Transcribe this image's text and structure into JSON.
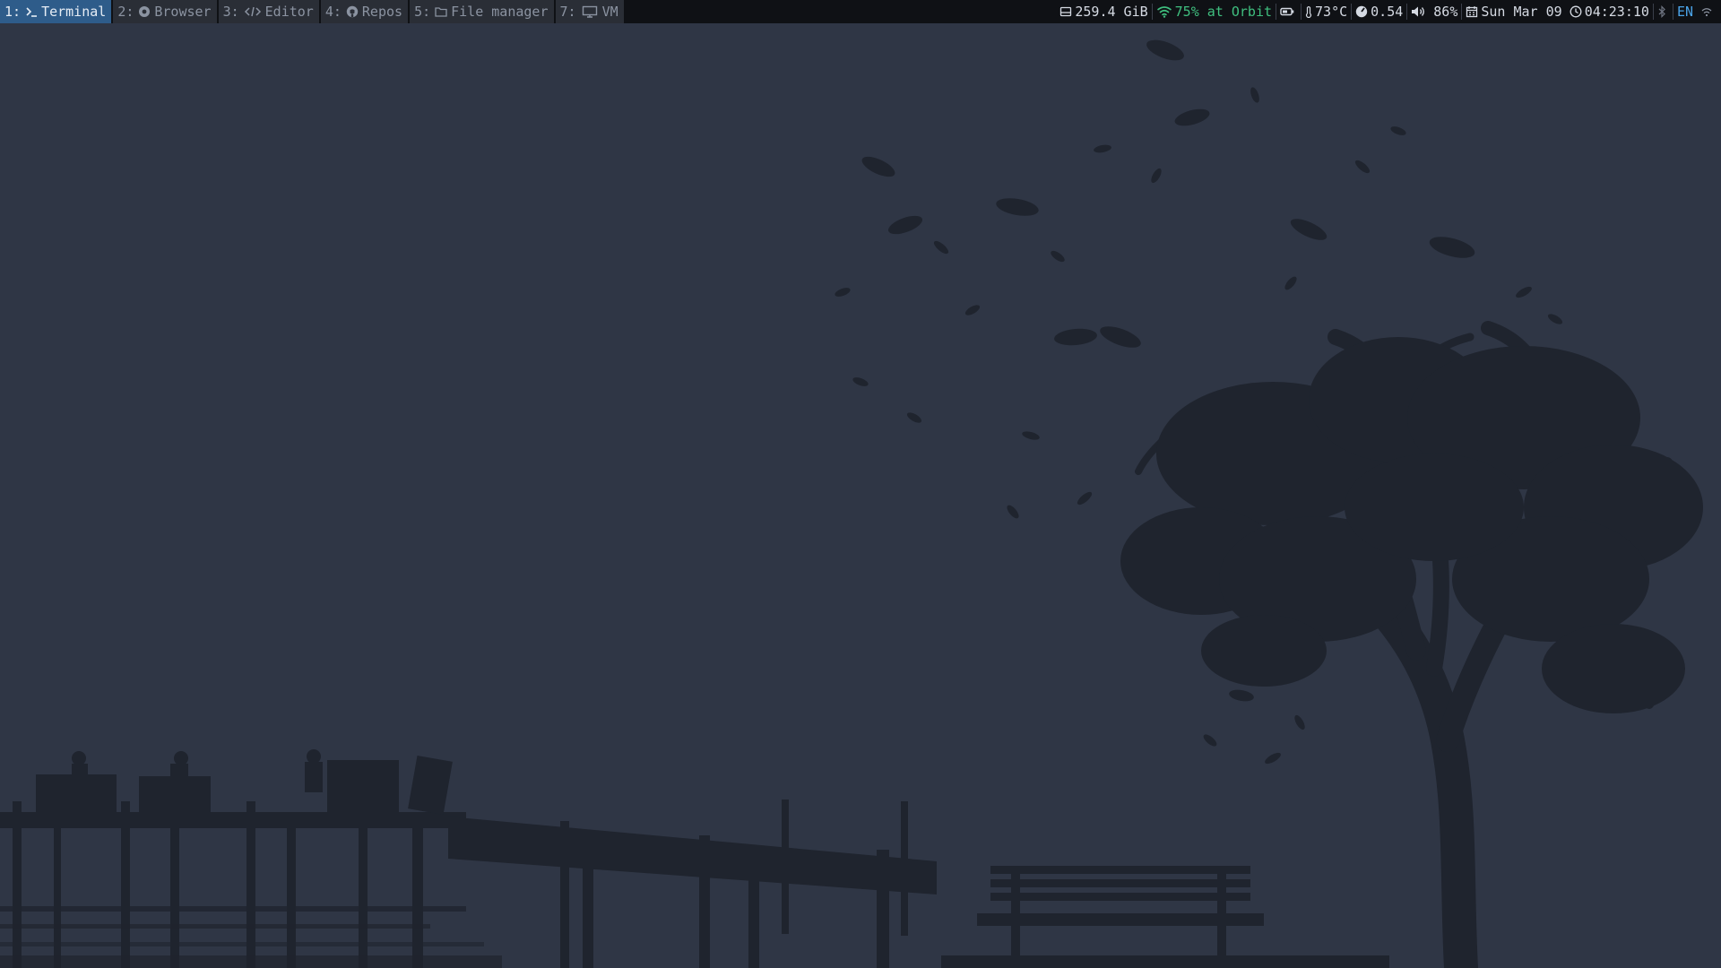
{
  "colors": {
    "background": "#2f3645",
    "bar_bg": "#0f1115",
    "active_workspace": "#2e5c8a",
    "wifi": "#3fbf7f",
    "lang": "#4aa3e8",
    "silhouette": "#1f242e"
  },
  "workspaces": [
    {
      "num": "1:",
      "label": "Terminal",
      "icon": "terminal-icon",
      "active": true
    },
    {
      "num": "2:",
      "label": "Browser",
      "icon": "browser-icon",
      "active": false
    },
    {
      "num": "3:",
      "label": "Editor",
      "icon": "code-icon",
      "active": false
    },
    {
      "num": "4:",
      "label": "Repos",
      "icon": "github-icon",
      "active": false
    },
    {
      "num": "5:",
      "label": "File manager",
      "icon": "folder-icon",
      "active": false
    },
    {
      "num": "7:",
      "label": "VM",
      "icon": "monitor-icon",
      "active": false
    }
  ],
  "status": {
    "disk": "259.4 GiB",
    "wifi": "75% at Orbit",
    "temperature": "73°C",
    "load": "0.54",
    "volume": "86%",
    "date": "Sun Mar 09",
    "time": "04:23:10",
    "lang": "EN"
  }
}
